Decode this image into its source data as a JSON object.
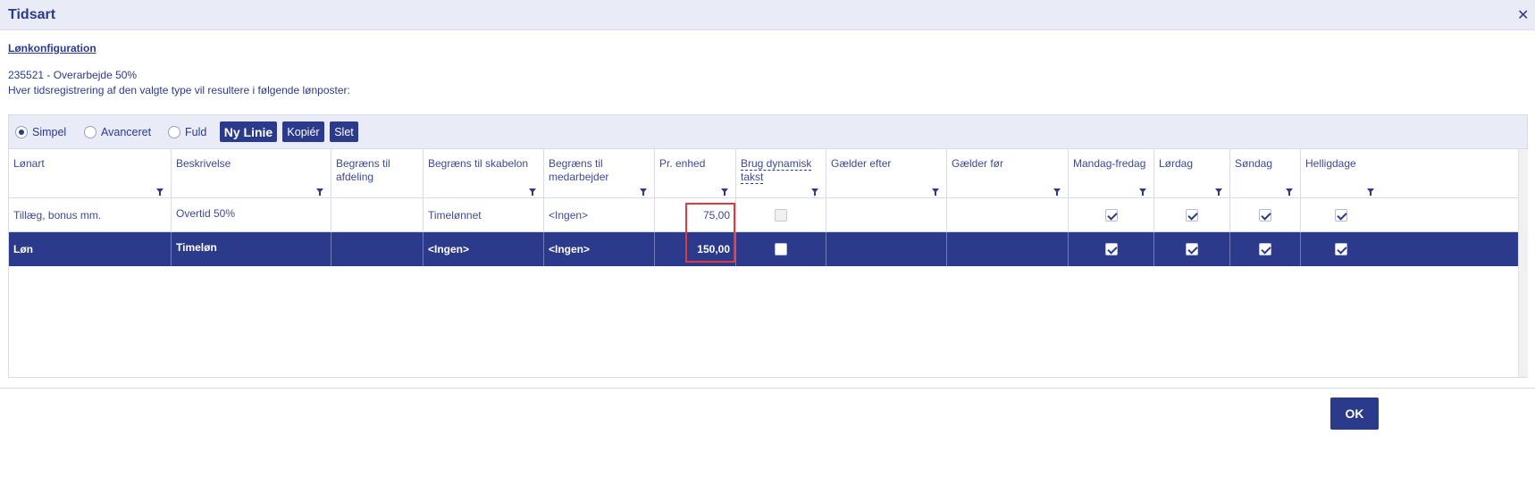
{
  "dialog": {
    "title": "Tidsart",
    "close_glyph": "✕"
  },
  "section": {
    "link_label": "Lønkonfiguration",
    "line1": "235521 - Overarbejde 50%",
    "line2": "Hver tidsregistrering af den valgte type vil resultere i følgende lønposter:"
  },
  "toolbar": {
    "radios": [
      {
        "label": "Simpel",
        "selected": true
      },
      {
        "label": "Avanceret",
        "selected": false
      },
      {
        "label": "Fuld",
        "selected": false
      }
    ],
    "new_line_label": "Ny Linie",
    "copy_label": "Kopiér",
    "delete_label": "Slet"
  },
  "table": {
    "columns": [
      "Lønart",
      "Beskrivelse",
      "Begræns til afdeling",
      "Begræns til skabelon",
      "Begræns til medarbejder",
      "Pr. enhed",
      "Brug dynamisk takst",
      "Gælder efter",
      "Gælder før",
      "Mandag-fredag",
      "Lørdag",
      "Søndag",
      "Helligdage"
    ],
    "rows": [
      {
        "lonart": "Tillæg, bonus mm.",
        "beskrivelse": "Overtid 50%",
        "afdeling": "",
        "skabelon": "Timelønnet",
        "medarbejder": "<Ingen>",
        "pr_enhed": "75,00",
        "dynamisk": false,
        "efter": "",
        "foer": "",
        "mandag_fredag": true,
        "loerdag": true,
        "soendag": true,
        "helligdage": true
      },
      {
        "lonart": "Løn",
        "beskrivelse": "Timeløn",
        "afdeling": "",
        "skabelon": "<Ingen>",
        "medarbejder": "<Ingen>",
        "pr_enhed": "150,00",
        "dynamisk": false,
        "efter": "",
        "foer": "",
        "mandag_fredag": true,
        "loerdag": true,
        "soendag": true,
        "helligdage": true
      }
    ]
  },
  "footer": {
    "ok_label": "OK"
  },
  "colors": {
    "accent": "#2b3a8a",
    "header_bg": "#e9ecf7",
    "highlight_box": "#e03b3b"
  }
}
